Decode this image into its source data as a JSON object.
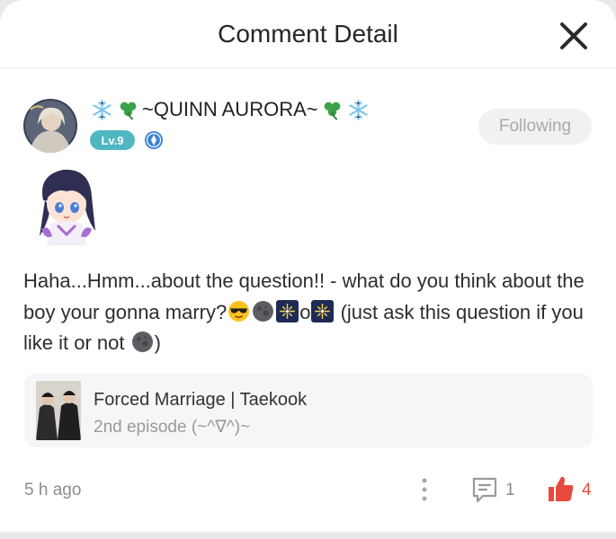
{
  "header": {
    "title": "Comment Detail"
  },
  "user": {
    "name": "~QUINN AURORA~",
    "level": "Lv.9",
    "follow_label": "Following"
  },
  "comment": {
    "part1": "Haha...Hmm...about the question!! - what do you think about the boy your gonna marry?",
    "part2": "o",
    "part3": " (just ask this question if you like it or not ",
    "part4": ")"
  },
  "story": {
    "title": "Forced Marriage | Taekook",
    "episode": "2nd episode (~^∇^)~"
  },
  "footer": {
    "time": "5 h ago",
    "reply_count": "1",
    "like_count": "4"
  },
  "colors": {
    "accent_like": "#e64a3c",
    "level_badge": "#4fb7c2"
  }
}
